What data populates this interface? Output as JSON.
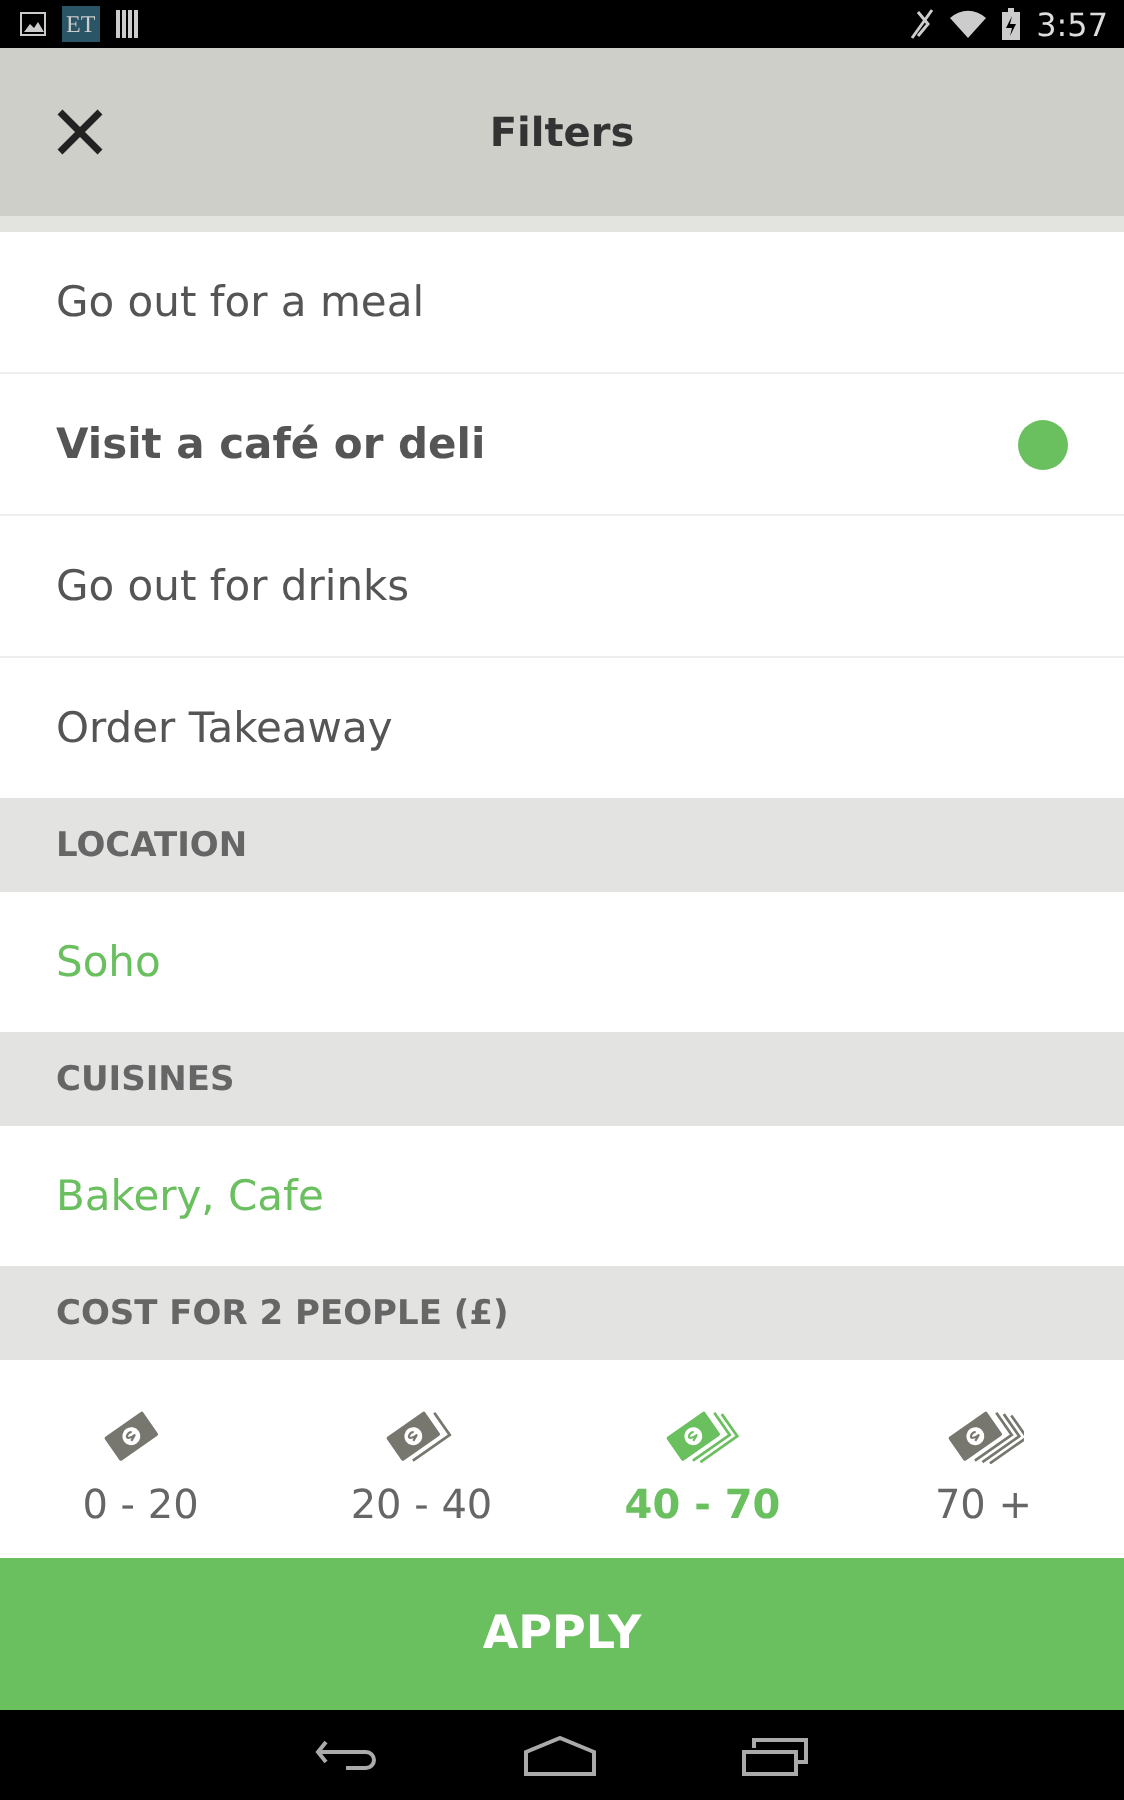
{
  "status_bar": {
    "notification_label": "ET",
    "time": "3:57"
  },
  "header": {
    "title": "Filters"
  },
  "options": [
    {
      "label": "Go out for a meal",
      "selected": false
    },
    {
      "label": "Visit a café or deli",
      "selected": true
    },
    {
      "label": "Go out for drinks",
      "selected": false
    },
    {
      "label": "Order Takeaway",
      "selected": false
    }
  ],
  "sections": [
    {
      "heading": "LOCATION",
      "value": "Soho"
    },
    {
      "heading": "CUISINES",
      "value": "Bakery, Cafe"
    }
  ],
  "cost": {
    "heading": "COST FOR 2 PEOPLE (£)",
    "ranges": [
      {
        "label": "0 - 20",
        "selected": false
      },
      {
        "label": "20 - 40",
        "selected": false
      },
      {
        "label": "40 - 70",
        "selected": true
      },
      {
        "label": "70 +",
        "selected": false
      }
    ]
  },
  "apply_button": "APPLY"
}
